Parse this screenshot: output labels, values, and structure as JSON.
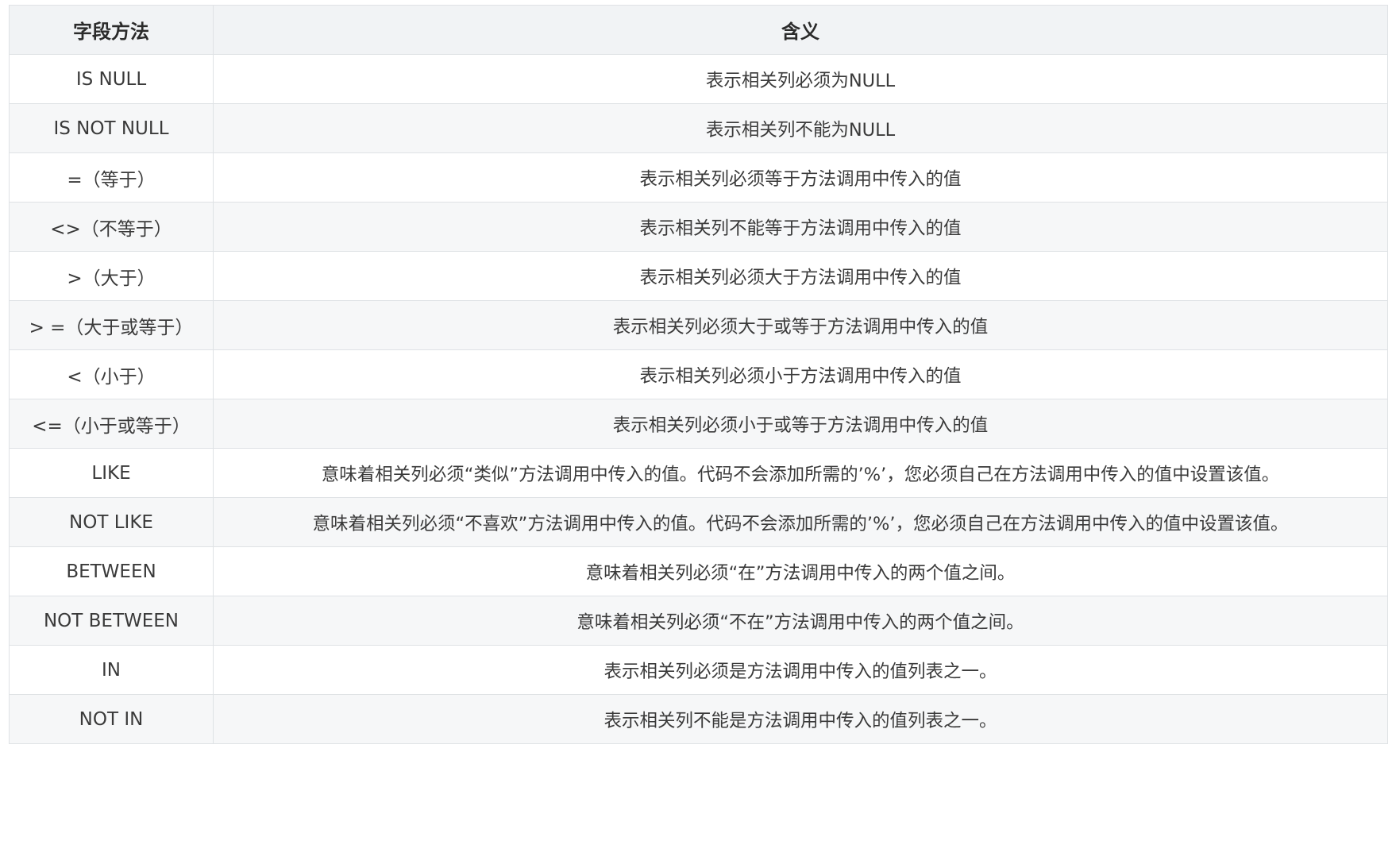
{
  "table": {
    "headers": [
      "字段方法",
      "含义"
    ],
    "rows": [
      [
        "IS NULL",
        "表示相关列必须为NULL"
      ],
      [
        "IS NOT NULL",
        "表示相关列不能为NULL"
      ],
      [
        "=（等于）",
        "表示相关列必须等于方法调用中传入的值"
      ],
      [
        "<>（不等于）",
        "表示相关列不能等于方法调用中传入的值"
      ],
      [
        ">（大于）",
        "表示相关列必须大于方法调用中传入的值"
      ],
      [
        "> =（大于或等于）",
        "表示相关列必须大于或等于方法调用中传入的值"
      ],
      [
        "<（小于）",
        "表示相关列必须小于方法调用中传入的值"
      ],
      [
        "<=（小于或等于）",
        "表示相关列必须小于或等于方法调用中传入的值"
      ],
      [
        "LIKE",
        "意味着相关列必须“类似”方法调用中传入的值。代码不会添加所需的’%’，您必须自己在方法调用中传入的值中设置该值。"
      ],
      [
        "NOT LIKE",
        "意味着相关列必须“不喜欢”方法调用中传入的值。代码不会添加所需的’%’，您必须自己在方法调用中传入的值中设置该值。"
      ],
      [
        "BETWEEN",
        "意味着相关列必须“在”方法调用中传入的两个值之间。"
      ],
      [
        "NOT BETWEEN",
        "意味着相关列必须“不在”方法调用中传入的两个值之间。"
      ],
      [
        "IN",
        "表示相关列必须是方法调用中传入的值列表之一。"
      ],
      [
        "NOT IN",
        "表示相关列不能是方法调用中传入的值列表之一。"
      ]
    ]
  }
}
